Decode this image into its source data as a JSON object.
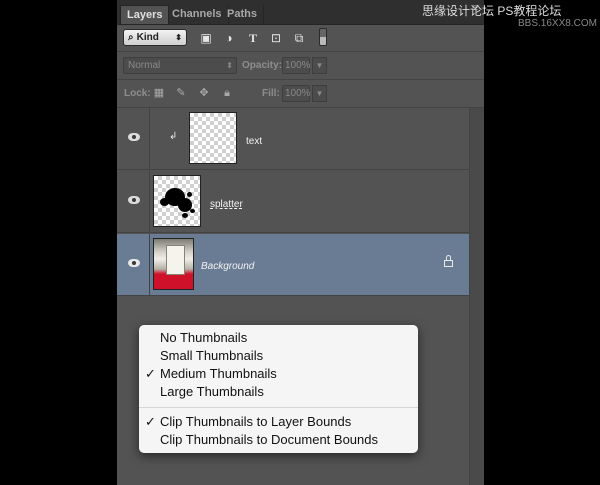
{
  "tabs": [
    "Layers",
    "Channels",
    "Paths"
  ],
  "filter": {
    "kind_label": "Kind",
    "icons": [
      "image-filter-icon",
      "adjustment-filter-icon",
      "type-filter-icon",
      "shape-filter-icon",
      "smart-object-filter-icon",
      "filter-toggle-switch"
    ]
  },
  "blend": {
    "mode": "Normal",
    "opacity_label": "Opacity:",
    "opacity_value": "100%",
    "lock_label": "Lock:",
    "fill_label": "Fill:",
    "fill_value": "100%",
    "lock_icons": [
      "lock-transparent-pixels-icon",
      "lock-image-pixels-icon",
      "lock-position-icon",
      "lock-all-icon"
    ]
  },
  "layers": [
    {
      "name": "text",
      "clipped": true,
      "thumbnail": "transparent",
      "selected": false,
      "locked": false
    },
    {
      "name": "splatter",
      "clipped": false,
      "thumbnail": "splatter",
      "selected": false,
      "locked": false
    },
    {
      "name": "Background",
      "clipped": false,
      "thumbnail": "photo",
      "selected": true,
      "locked": true
    }
  ],
  "context_menu": {
    "items": [
      {
        "label": "No Thumbnails",
        "checked": false
      },
      {
        "label": "Small Thumbnails",
        "checked": false
      },
      {
        "label": "Medium Thumbnails",
        "checked": true
      },
      {
        "label": "Large Thumbnails",
        "checked": false
      },
      {
        "label": "Clip Thumbnails to Layer Bounds",
        "checked": true
      },
      {
        "label": "Clip Thumbnails to Document Bounds",
        "checked": false
      }
    ],
    "check_glyph": "✓"
  },
  "watermark": {
    "line1": "思缘设计论坛  PS教程论坛",
    "line2": "BBS.16XX8.COM"
  },
  "colors": {
    "panel_bg": "#535353",
    "selected_row": "#6a7b94",
    "menu_bg": "#f5f5f5"
  }
}
